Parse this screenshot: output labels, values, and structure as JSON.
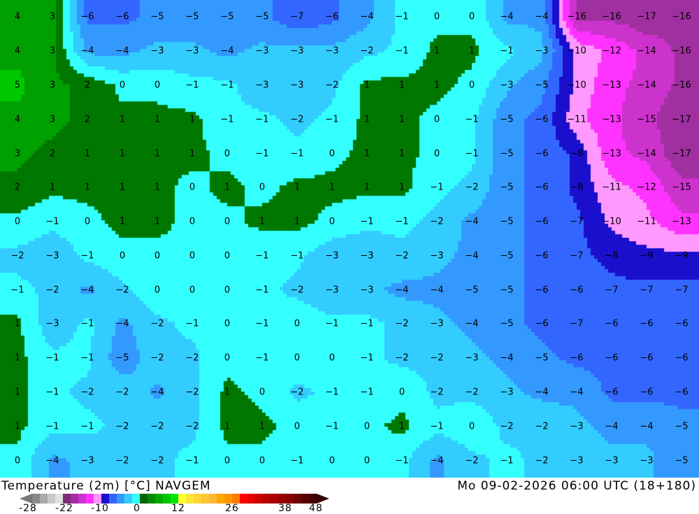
{
  "title_left": "Temperature (2m) [°C] NAVGEM",
  "title_right": "Mo 09-02-2026 06:00 UTC (18+180)",
  "band_colors": {
    "ge5": "#00c800",
    "ge3": "#00a000",
    "ge1": "#007800",
    "ge-1": "#33ffff",
    "ge-3": "#33ccff",
    "ge-5": "#3399ff",
    "ge-7": "#3366ff",
    "ge-9": "#1a0fcc",
    "ge-11": "#ff99ff",
    "ge-13": "#ff33ff",
    "ge-15": "#cc33cc",
    "lt-15": "#a030a0"
  },
  "temperature_grid": [
    [
      4,
      3,
      -6,
      -6,
      -5,
      -5,
      -5,
      -5,
      -7,
      -6,
      -4,
      -1,
      0,
      0,
      -4,
      -4,
      -16,
      -16,
      -17,
      -16
    ],
    [
      4,
      3,
      -4,
      -4,
      -3,
      -3,
      -4,
      -3,
      -3,
      -3,
      -2,
      -1,
      1,
      1,
      -1,
      -3,
      -10,
      -12,
      -14,
      -16
    ],
    [
      5,
      3,
      2,
      0,
      0,
      -1,
      -1,
      -3,
      -3,
      -2,
      1,
      1,
      1,
      0,
      -3,
      -5,
      -10,
      -13,
      -14,
      -16
    ],
    [
      4,
      3,
      2,
      1,
      1,
      1,
      -1,
      -1,
      -2,
      -1,
      1,
      1,
      0,
      -1,
      -5,
      -6,
      -11,
      -13,
      -15,
      -17
    ],
    [
      3,
      2,
      1,
      1,
      1,
      1,
      0,
      -1,
      -1,
      0,
      1,
      1,
      0,
      -1,
      -5,
      -6,
      -8,
      -13,
      -14,
      -17
    ],
    [
      2,
      1,
      1,
      1,
      1,
      0,
      1,
      0,
      1,
      1,
      1,
      1,
      -1,
      -2,
      -5,
      -6,
      -8,
      -11,
      -12,
      -15
    ],
    [
      0,
      -1,
      0,
      1,
      1,
      0,
      0,
      1,
      1,
      0,
      -1,
      -1,
      -2,
      -4,
      -5,
      -6,
      -7,
      -10,
      -11,
      -13
    ],
    [
      -2,
      -3,
      -1,
      0,
      0,
      0,
      0,
      -1,
      -1,
      -3,
      -3,
      -2,
      -3,
      -4,
      -5,
      -6,
      -7,
      -8,
      -9,
      -9
    ],
    [
      -1,
      -2,
      -4,
      -2,
      0,
      0,
      0,
      -1,
      -2,
      -3,
      -3,
      -4,
      -4,
      -5,
      -5,
      -6,
      -6,
      -7,
      -7,
      -7
    ],
    [
      1,
      -3,
      -1,
      -4,
      -2,
      -1,
      0,
      -1,
      0,
      -1,
      -1,
      -2,
      -3,
      -4,
      -5,
      -6,
      -7,
      -6,
      -6,
      -6
    ],
    [
      1,
      -1,
      -1,
      -5,
      -2,
      -2,
      0,
      -1,
      0,
      0,
      -1,
      -2,
      -2,
      -3,
      -4,
      -5,
      -6,
      -6,
      -6,
      -6
    ],
    [
      1,
      -1,
      -2,
      -2,
      -4,
      -2,
      1,
      0,
      -2,
      -1,
      -1,
      0,
      -2,
      -2,
      -3,
      -4,
      -4,
      -6,
      -6,
      -6
    ],
    [
      1,
      -1,
      -1,
      -2,
      -2,
      -2,
      1,
      1,
      0,
      -1,
      0,
      1,
      -1,
      0,
      -2,
      -2,
      -3,
      -4,
      -4,
      -5
    ],
    [
      0,
      -4,
      -3,
      -2,
      -2,
      -1,
      0,
      0,
      -1,
      0,
      0,
      -1,
      -4,
      -2,
      -1,
      -2,
      -3,
      -3,
      -3,
      -5
    ]
  ],
  "colorbar": {
    "colors": [
      "#888888",
      "#aaaaaa",
      "#c8c8c8",
      "#e2e2e2",
      "#7a2e7a",
      "#a52ea5",
      "#cc33cc",
      "#ff33ff",
      "#ff99ff",
      "#1a0fcc",
      "#3366ff",
      "#3399ff",
      "#33ccff",
      "#33ffff",
      "#006400",
      "#008c00",
      "#00aa00",
      "#00c800",
      "#00e600",
      "#ffff33",
      "#ffe633",
      "#ffd633",
      "#ffc633",
      "#ffb633",
      "#ffa600",
      "#ff9600",
      "#ff7a00",
      "#ff0000",
      "#e60000",
      "#cc0000",
      "#b80000",
      "#a80000",
      "#980000",
      "#880000",
      "#700000",
      "#580000",
      "#440000"
    ],
    "ticks": [
      "-28",
      "-22",
      "-10",
      "0",
      "12",
      "26",
      "38",
      "48"
    ]
  }
}
